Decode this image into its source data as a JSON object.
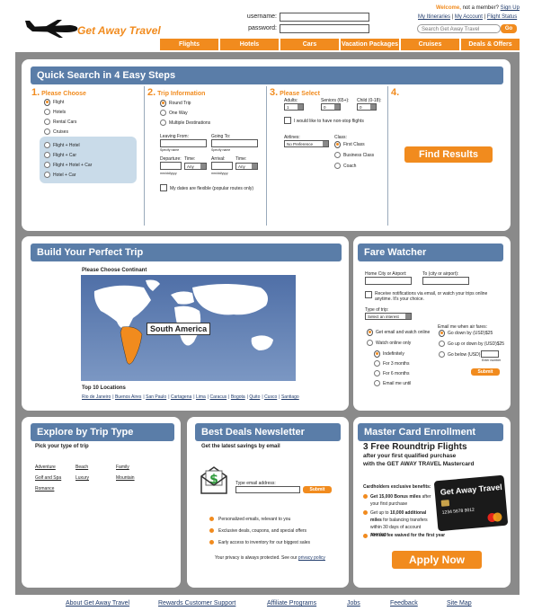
{
  "brand": {
    "name": "Get Away Travel"
  },
  "login": {
    "welcome": "Welcome,",
    "not_member": "not a member?",
    "sign_up": "Sign Up",
    "username_label": "username:",
    "password_label": "password:",
    "links": [
      "My Itineraries",
      "My Account",
      "Flight Status"
    ],
    "sep": "|"
  },
  "search": {
    "placeholder": "Search Get Away Travel",
    "button": "Go"
  },
  "nav": [
    "Flights",
    "Hotels",
    "Cars",
    "Vacation Packages",
    "Cruises",
    "Deals & Offers"
  ],
  "quick_search": {
    "title": "Quick Search in 4 Easy Steps",
    "step1": {
      "num": "1.",
      "title": "Please Choose",
      "options": [
        "Flight",
        "Hotels",
        "Rental Cars",
        "Cruises"
      ],
      "combos": [
        "Flight + Hotel",
        "Flight + Car",
        "Flight + Hotel + Car",
        "Hotel + Car"
      ]
    },
    "step2": {
      "num": "2.",
      "title": "Trip Information",
      "trip_types": [
        "Round Trip",
        "One Way",
        "Multiple Destinations"
      ],
      "leaving_from": "Leaving From:",
      "going_to": "Going To:",
      "specify_name": "Specify name",
      "departure": "Departure:",
      "arrival": "Arrival:",
      "time": "Time:",
      "time_value": "Any",
      "date_format": "mm/dd/yyyy",
      "flexible": "My dates are flexible (popular routes only)"
    },
    "step3": {
      "num": "3.",
      "title": "Please Select",
      "adults": "Adults:",
      "seniors": "Seniors (65+):",
      "child": "Child (0-18):",
      "adults_val": "1",
      "seniors_val": "0",
      "child_val": "0",
      "nonstop": "I would like to have non-stop flights",
      "airlines": "Airlines:",
      "airlines_val": "No Preference",
      "class": "Class:",
      "classes": [
        "First Class",
        "Business Class",
        "Coach"
      ]
    },
    "step4": {
      "num": "4.",
      "button": "Find Results"
    }
  },
  "build_trip": {
    "title": "Build Your Perfect Trip",
    "choose": "Please Choose Continant",
    "selected": "South America",
    "top10_title": "Top 10 Locations",
    "cities": [
      "Rio de Janeiro",
      "Buenos Aires",
      "San Paulo",
      "Cartagena",
      "Lima",
      "Caracus",
      "Bogota",
      "Quito",
      "Cusco",
      "Santiago"
    ]
  },
  "fare_watcher": {
    "title": "Fare Watcher",
    "home_city": "Home City or Airport:",
    "to_city": "To (city or airport):",
    "notify": "Receive notifications via email, or watch your trips online anytime. It's your choice.",
    "type_of_trip": "Type of trip:",
    "type_val": "Select an interest",
    "email_when": "Email me when air fares:",
    "watch_options": [
      "Get email and watch online",
      "Watch online only"
    ],
    "durations": [
      "Indefinitely",
      "For 3 months",
      "For 6 months",
      "Email me until"
    ],
    "fare_options": [
      "Go down by (USD)$25",
      "Go up or down by (USD)$25",
      "Go below (USD)"
    ],
    "enter_number": "Enter number",
    "submit": "Submit"
  },
  "explore": {
    "title": "Explore by Trip Type",
    "subtitle": "Pick your type of trip",
    "types": [
      "Adventure",
      "Beach",
      "Family",
      "Golf and Spa",
      "Luxury",
      "Mountain",
      "Romance"
    ]
  },
  "newsletter": {
    "title": "Best Deals Newsletter",
    "subtitle": "Get the latest savings by email",
    "email_label": "Type email address:",
    "submit": "Submit",
    "benefits": [
      "Personalized emails, relevant to you",
      "Exclusive deals, coupons, and special offers",
      "Early access to inventory for our biggest sales"
    ],
    "privacy": "Your privacy is always protected.  See our",
    "privacy_link": "privacy policy"
  },
  "mastercard": {
    "title": "Master Card Enrollment",
    "headline1": "3 Free Roundtrip Flights",
    "headline2": "after your first qualified purchase",
    "headline3": "with the GET AWAY TRAVEL Mastercard",
    "benefits_title": "Cardholders exclusive benefits:",
    "benefits": [
      {
        "bold": "Get 15,000 Bonus miles",
        "rest": " after your first purchase"
      },
      {
        "bold": "",
        "rest": "Get up to ",
        "bold2": "10,000 additional miles",
        "rest2": " for balancing transfers within 30 days of account opening"
      },
      {
        "bold": "Annual fee waived for the first year",
        "rest": ""
      }
    ],
    "card_brand": "Get Away Travel",
    "card_number": "1234 5678 9012",
    "button": "Apply Now"
  },
  "footer": [
    "About Get Away Travel",
    "Rewards  Customer Support",
    "Affiliate Programs",
    "Jobs",
    "Feedback",
    "Site Map"
  ]
}
